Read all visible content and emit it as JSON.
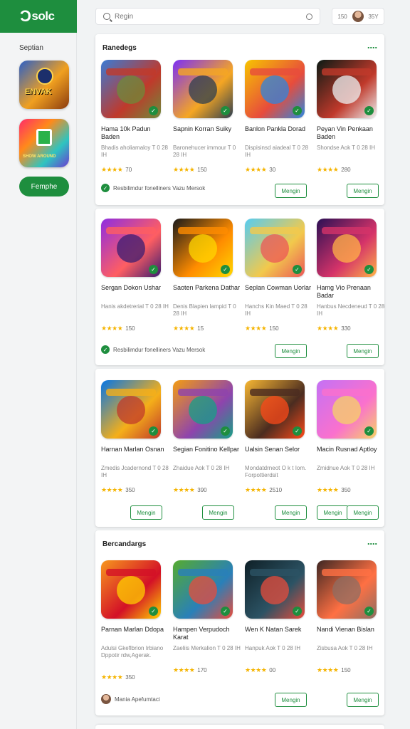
{
  "brand": {
    "logo": "Ɔ",
    "name": "solc",
    "color": "#1e8e3e"
  },
  "sidebar": {
    "title": "Septian",
    "apps": [
      {
        "label": "ENVAK",
        "icon": "emblem-icon"
      },
      {
        "label": "SHOW AROUND",
        "icon": "shopping-bag-icon"
      }
    ],
    "button": "Femphe"
  },
  "search": {
    "placeholder": "Regin",
    "icon": "search-icon",
    "mic_icon": "mic-icon"
  },
  "user": {
    "left": "150",
    "right": "35Y"
  },
  "sections": [
    {
      "title": "Ranedegs",
      "apps": [
        {
          "name": "Hama 10k Padun Baden",
          "desc": "Bhadis aholiamaloy T 0 28 IH",
          "rating": "70",
          "colors": [
            "#3a7bd5",
            "#c0392b",
            "#6d8b3a"
          ]
        },
        {
          "name": "Sapnin Korran Suiky",
          "desc": "Baronehucer immour T 0 28 IH",
          "rating": "150",
          "colors": [
            "#7b2ff7",
            "#f5a623",
            "#2c3e50"
          ]
        },
        {
          "name": "Banlon Pankla Dorad",
          "desc": "Dispisinsd aiadeal T 0 28 IH",
          "rating": "30",
          "colors": [
            "#f7c400",
            "#e74c3c",
            "#2e86de"
          ]
        },
        {
          "name": "Peyan Vin Penkaan Baden",
          "desc": "Shondse Aok T 0 28 IH",
          "rating": "280",
          "colors": [
            "#0b1a14",
            "#c0392b",
            "#ecf0f1"
          ]
        }
      ],
      "footer": {
        "text": "Resbilimdur fonelliners Vazu Mersok"
      },
      "buttons": [
        "Mengin",
        "Mengin"
      ]
    },
    {
      "title": "",
      "apps": [
        {
          "name": "Sergan Dokon Ushar",
          "desc": "Hanis akdetrerial T 0 28 IH",
          "rating": "150",
          "colors": [
            "#8e2de2",
            "#ff5e62",
            "#3a1c71"
          ]
        },
        {
          "name": "Saoten Parkena Dathar",
          "desc": "Denis Blapien lampid T 0 28 IH",
          "rating": "15",
          "colors": [
            "#1a1a1a",
            "#ff8c00",
            "#ffd700"
          ]
        },
        {
          "name": "Seplan Cowman Uorlar",
          "desc": "Hanchs Kin Maed T 0 28 IH",
          "rating": "150",
          "colors": [
            "#56ccf2",
            "#f2c94c",
            "#eb5757"
          ]
        },
        {
          "name": "Hamg Vio Prenaan Badar",
          "desc": "Hanbus Necdeneud T 0 28 IH",
          "rating": "330",
          "colors": [
            "#2b1055",
            "#d53369",
            "#ffb347"
          ]
        }
      ],
      "footer": {
        "text": "Resbilimdur fonelliners Vazu Mersok"
      },
      "buttons": [
        "Mengin",
        "Mengin"
      ]
    },
    {
      "title": "",
      "apps": [
        {
          "name": "Harnan Marlan Osnan",
          "desc": "Zmedis Jcadernond T 0 28 IH",
          "rating": "350",
          "colors": [
            "#0575e6",
            "#f5af19",
            "#c0392b"
          ]
        },
        {
          "name": "Segian Fonitino Kellpar",
          "desc": "Zhaidue Aok T 0 28 IH",
          "rating": "390",
          "colors": [
            "#f39c12",
            "#8e44ad",
            "#16a085"
          ]
        },
        {
          "name": "Ualsin Senan Selor",
          "desc": "Mondatdrneot O k t Iom. Forpottierdsit",
          "rating": "2510",
          "colors": [
            "#f7b733",
            "#4b2c20",
            "#fc4a1a"
          ]
        },
        {
          "name": "Macin Rusnad Aptloy",
          "desc": "Zmidnue Aok T 0 28 IH",
          "rating": "350",
          "colors": [
            "#c471f5",
            "#fa71cd",
            "#f6d365"
          ]
        }
      ],
      "footer": null,
      "buttons": [
        "Mengin",
        "Mengin",
        "Mengin",
        "Mengin",
        "Mengin"
      ]
    },
    {
      "title": "Bercandargs",
      "apps": [
        {
          "name": "Parnan Marlan Ddopa",
          "desc": "Adulsi Gkeflbrion Irbiano Dppotir rdw,Agerak.",
          "rating": "350",
          "colors": [
            "#f7971e",
            "#d31027",
            "#ffd200"
          ]
        },
        {
          "name": "Hampen Verpudoch Karat",
          "desc": "Zaeliis Merkalion T 0 28 IH",
          "rating": "170",
          "colors": [
            "#56ab2f",
            "#2980b9",
            "#e74c3c"
          ]
        },
        {
          "name": "Wen K Natan Sarek",
          "desc": "Hanpuk Aok T 0 28 IH",
          "rating": "00",
          "colors": [
            "#0f2027",
            "#2c5364",
            "#e74c3c"
          ]
        },
        {
          "name": "Nandi Vienan Bislan",
          "desc": "Zisbusa Aok T 0 28 IH",
          "rating": "150",
          "colors": [
            "#3e2723",
            "#ff7043",
            "#8d6e63"
          ]
        }
      ],
      "footer": {
        "text": "Mania Apefumtaci",
        "avatar": true
      },
      "buttons": [
        "Mengin",
        "Mengin"
      ]
    }
  ]
}
